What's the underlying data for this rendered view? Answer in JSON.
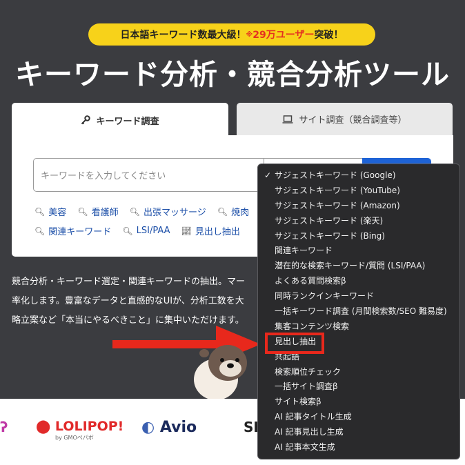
{
  "header": {
    "badge_prefix": "日本語キーワード数最大級！",
    "badge_note": "※",
    "badge_highlight": "29万ユーザー",
    "badge_suffix": "突破！",
    "title": "キーワード分析・競合分析ツール"
  },
  "tabs": [
    {
      "label": "キーワード調査",
      "icon": "key-icon",
      "active": true
    },
    {
      "label": "サイト調査（競合調査等）",
      "icon": "laptop-icon",
      "active": false
    }
  ],
  "search": {
    "placeholder": "キーワードを入力してください"
  },
  "quick_links_row1": [
    {
      "label": "美容",
      "icon": "search-icon"
    },
    {
      "label": "看護師",
      "icon": "search-icon"
    },
    {
      "label": "出張マッサージ",
      "icon": "search-icon"
    },
    {
      "label": "焼肉",
      "icon": "search-icon"
    }
  ],
  "quick_links_row2": [
    {
      "label": "関連キーワード",
      "icon": "search-icon"
    },
    {
      "label": "LSI/PAA",
      "icon": "search-icon"
    },
    {
      "label": "見出し抽出",
      "icon": "chart-icon"
    }
  ],
  "description": [
    "競合分析・キーワード選定・関連キーワードの抽出。マー",
    "率化します。豊富なデータと直感的なUIが、分析工数を大",
    "略立案など「本当にやるべきこと」に集中いただけます。"
  ],
  "partners": [
    "LOLIPOP!",
    "Avio"
  ],
  "partners_sub": "by GMOペパボ",
  "dropdown": {
    "selected_index": 0,
    "highlight_index": 11,
    "items": [
      "サジェストキーワード (Google)",
      "サジェストキーワード (YouTube)",
      "サジェストキーワード (Amazon)",
      "サジェストキーワード (楽天)",
      "サジェストキーワード (Bing)",
      "関連キーワード",
      "潜在的な検索キーワード/質問 (LSI/PAA)",
      "よくある質問検索β",
      "同時ランクインキーワード",
      "一括キーワード調査 (月間検索数/SEO 難易度)",
      "集客コンテンツ検索",
      "見出し抽出",
      "共起語",
      "検索順位チェック",
      "一括サイト調査β",
      "サイト検索β",
      "AI 記事タイトル生成",
      "AI 記事見出し生成",
      "AI 記事本文生成"
    ]
  },
  "colors": {
    "background": "#3b3c40",
    "badge": "#f7d21a",
    "accent_red": "#e53020",
    "search_button": "#1e63d6"
  }
}
